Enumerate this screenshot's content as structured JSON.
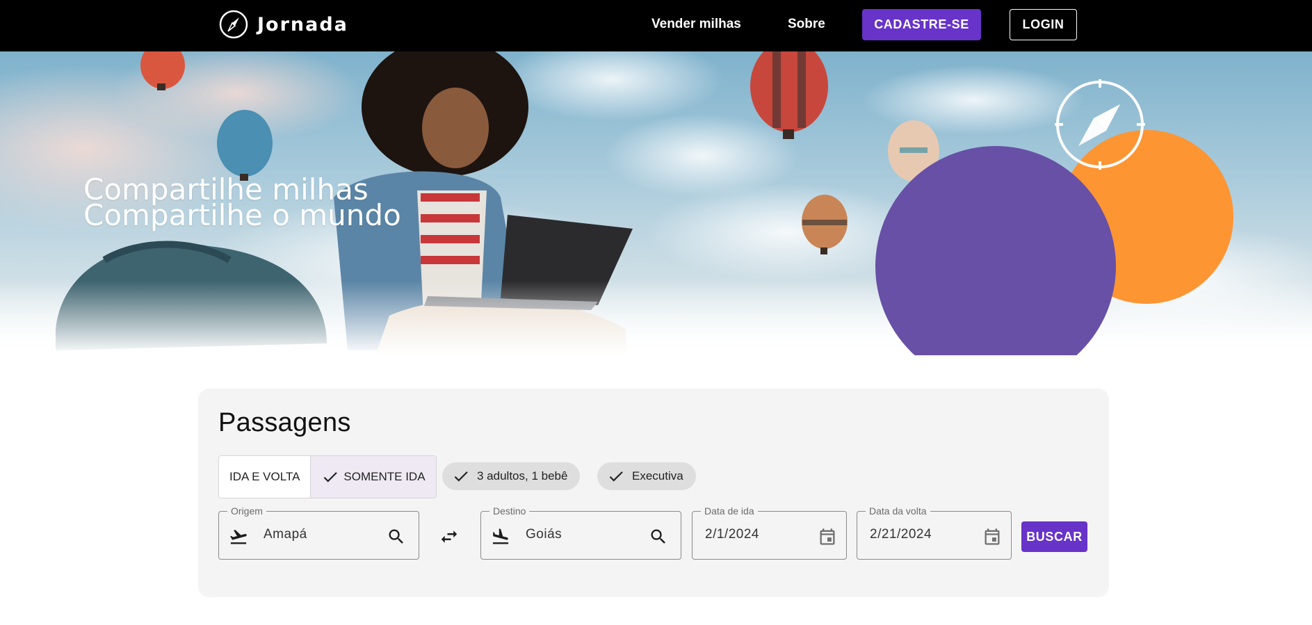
{
  "brand": {
    "name": "Jornada",
    "logo_icon": "compass-icon"
  },
  "nav": {
    "sell_miles": "Vender milhas",
    "about": "Sobre",
    "signup": "CADASTRE-SE",
    "login": "LOGIN"
  },
  "hero": {
    "line1": "Compartilhe milhas",
    "line2": "Compartilhe o mundo",
    "colors": {
      "orange": "#fe9533",
      "purple": "#6750a6"
    }
  },
  "search": {
    "title": "Passagens",
    "trip_type": {
      "round_trip": "IDA E VOLTA",
      "one_way": "SOMENTE IDA",
      "selected": "SOMENTE IDA"
    },
    "passengers_chip": "3 adultos, 1 bebê",
    "class_chip": "Executiva",
    "origin": {
      "label": "Origem",
      "value": "Amapá",
      "icon": "flight-takeoff-icon"
    },
    "destination": {
      "label": "Destino",
      "value": "Goiás",
      "icon": "flight-land-icon"
    },
    "departure_date": {
      "label": "Data de ida",
      "value": "2/1/2024"
    },
    "return_date": {
      "label": "Data da volta",
      "value": "2/21/2024"
    },
    "submit": "BUSCAR"
  },
  "colors": {
    "primary": "#6733c9",
    "header_bg": "#000000",
    "card_bg": "#f4f4f4"
  }
}
